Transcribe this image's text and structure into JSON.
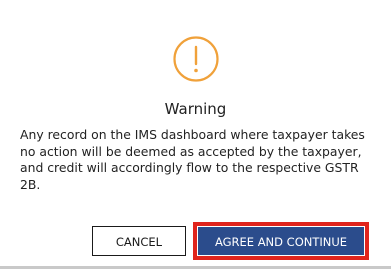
{
  "dialog": {
    "icon": "warning-circle-icon",
    "accent_color": "#f0a13a",
    "title": "Warning",
    "message_lines": [
      "Any record on the IMS dashboard where taxpayer takes",
      "no action will be deemed as accepted by the taxpayer,",
      "and credit will accordingly flow to the respective GSTR",
      "2B."
    ],
    "cancel_label": "CANCEL",
    "agree_label": "AGREE AND CONTINUE",
    "primary_color": "#2b4c8c",
    "highlight_color": "#e0241c"
  }
}
